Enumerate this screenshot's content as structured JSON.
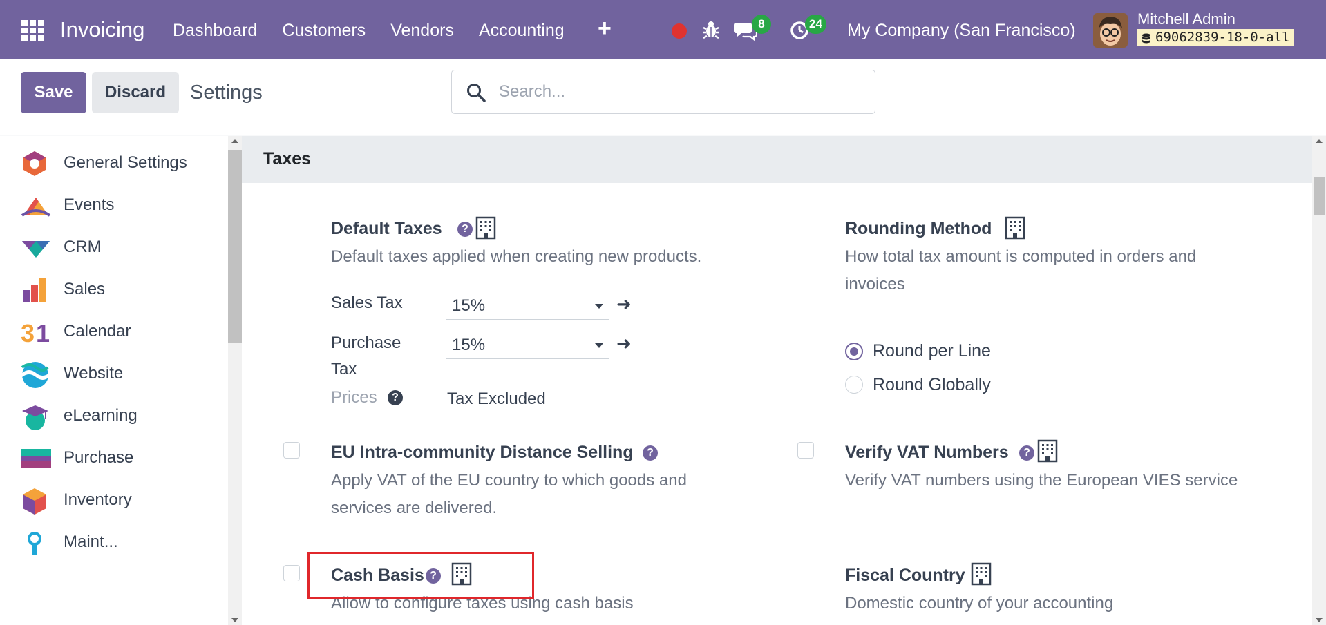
{
  "navbar": {
    "app_name": "Invoicing",
    "menu": [
      "Dashboard",
      "Customers",
      "Vendors",
      "Accounting"
    ],
    "plus_label": "+",
    "chat_count": "8",
    "activity_count": "24",
    "company": "My Company (San Francisco)",
    "user_name": "Mitchell Admin",
    "db_name": "69062839-18-0-all",
    "color": "#71639e"
  },
  "control": {
    "save_label": "Save",
    "discard_label": "Discard",
    "title": "Settings",
    "search_placeholder": "Search..."
  },
  "sidebar": {
    "items": [
      {
        "label": "General Settings",
        "icon": "general-settings-icon"
      },
      {
        "label": "Events",
        "icon": "events-icon"
      },
      {
        "label": "CRM",
        "icon": "crm-icon"
      },
      {
        "label": "Sales",
        "icon": "sales-icon"
      },
      {
        "label": "Calendar",
        "icon": "calendar-icon"
      },
      {
        "label": "Website",
        "icon": "website-icon"
      },
      {
        "label": "eLearning",
        "icon": "elearning-icon"
      },
      {
        "label": "Purchase",
        "icon": "purchase-icon"
      },
      {
        "label": "Inventory",
        "icon": "inventory-icon"
      },
      {
        "label": "Maint...",
        "icon": "maintenance-icon"
      }
    ]
  },
  "section": {
    "title": "Taxes"
  },
  "settings": {
    "default_taxes": {
      "title": "Default Taxes",
      "desc": "Default taxes applied when creating new products.",
      "sales_tax_label": "Sales Tax",
      "sales_tax_value": "15%",
      "purchase_tax_label_1": "Purchase",
      "purchase_tax_label_2": "Tax",
      "purchase_tax_value": "15%",
      "prices_label": "Prices",
      "prices_value": "Tax Excluded"
    },
    "rounding": {
      "title": "Rounding Method",
      "desc_1": "How total tax amount is computed in orders and",
      "desc_2": "invoices",
      "option_1": "Round per Line",
      "option_2": "Round Globally",
      "selected": "Round per Line"
    },
    "eu_distance": {
      "title": "EU Intra-community Distance Selling",
      "desc_1": "Apply VAT of the EU country to which goods and",
      "desc_2": "services are delivered."
    },
    "verify_vat": {
      "title": "Verify VAT Numbers",
      "desc": "Verify VAT numbers using the European VIES service"
    },
    "cash_basis": {
      "title": "Cash Basis",
      "desc": "Allow to configure taxes using cash basis"
    },
    "fiscal_country": {
      "title": "Fiscal Country",
      "desc": "Domestic country of your accounting"
    }
  }
}
